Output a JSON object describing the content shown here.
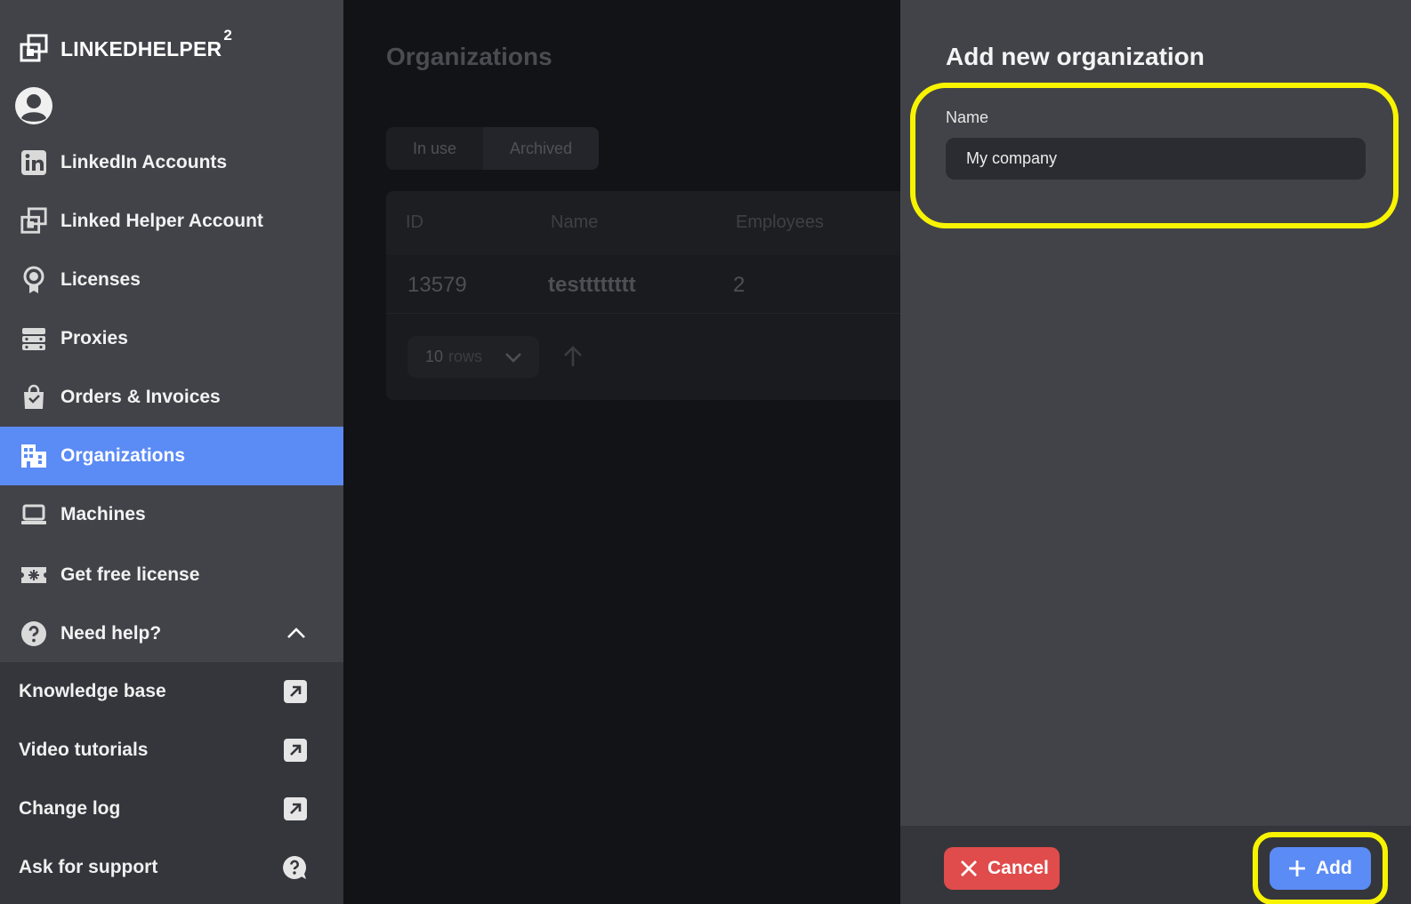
{
  "brand": {
    "name": "LINKEDHELPER",
    "version": "2"
  },
  "nav": {
    "items": [
      {
        "label": "LinkedIn Accounts",
        "icon": "linkedin-icon"
      },
      {
        "label": "Linked Helper Account",
        "icon": "linkedhelper-icon"
      },
      {
        "label": "Licenses",
        "icon": "award-icon"
      },
      {
        "label": "Proxies",
        "icon": "server-icon"
      },
      {
        "label": "Orders & Invoices",
        "icon": "shopping-bag-icon"
      },
      {
        "label": "Organizations",
        "icon": "building-icon",
        "active": true
      },
      {
        "label": "Machines",
        "icon": "laptop-icon"
      },
      {
        "label": "Get free license",
        "icon": "ticket-icon"
      },
      {
        "label": "Need help?",
        "icon": "help-icon"
      }
    ],
    "help_items": [
      {
        "label": "Knowledge base",
        "icon": "external-link-icon"
      },
      {
        "label": "Video tutorials",
        "icon": "external-link-icon"
      },
      {
        "label": "Change log",
        "icon": "external-link-icon"
      },
      {
        "label": "Ask for support",
        "icon": "chat-question-icon"
      }
    ]
  },
  "main": {
    "title": "Organizations",
    "tabs": [
      {
        "label": "In use"
      },
      {
        "label": "Archived"
      }
    ],
    "table": {
      "headers": [
        "ID",
        "Name",
        "Employees"
      ],
      "rows": [
        {
          "id": "13579",
          "name": "testttttttt",
          "employees": "2"
        }
      ]
    },
    "pagination": {
      "rows_value": "10",
      "rows_label": "rows"
    }
  },
  "drawer": {
    "title": "Add new organization",
    "name_label": "Name",
    "name_value": "My company",
    "cancel_label": "Cancel",
    "add_label": "Add"
  },
  "colors": {
    "accent": "#5b8bf5",
    "danger": "#e04b4b",
    "highlight": "#f8f400",
    "sidebar_bg": "#424349"
  }
}
